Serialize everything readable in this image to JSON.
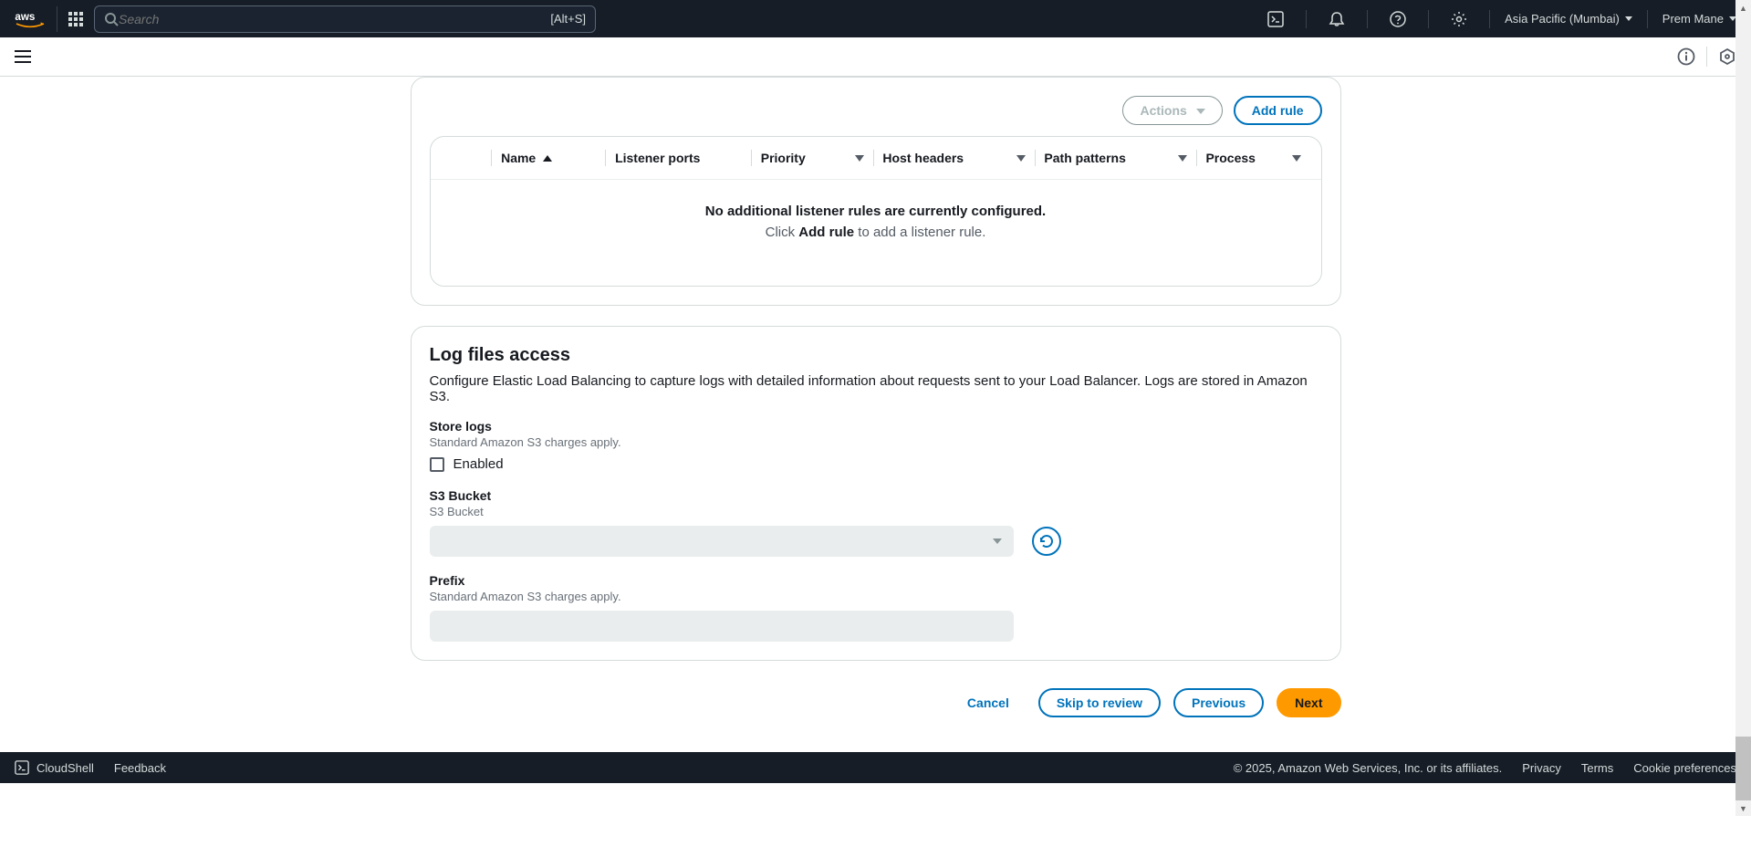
{
  "header": {
    "search_placeholder": "Search",
    "search_shortcut": "[Alt+S]",
    "region": "Asia Pacific (Mumbai)",
    "user": "Prem Mane"
  },
  "rules_panel": {
    "actions_label": "Actions",
    "add_rule_label": "Add rule",
    "columns": {
      "name": "Name",
      "listener_ports": "Listener ports",
      "priority": "Priority",
      "host_headers": "Host headers",
      "path_patterns": "Path patterns",
      "process": "Process"
    },
    "empty_title": "No additional listener rules are currently configured.",
    "empty_sub_before": "Click ",
    "empty_sub_bold": "Add rule",
    "empty_sub_after": " to add a listener rule."
  },
  "log_panel": {
    "title": "Log files access",
    "description": "Configure Elastic Load Balancing to capture logs with detailed information about requests sent to your Load Balancer. Logs are stored in Amazon S3.",
    "store_logs_label": "Store logs",
    "store_logs_hint": "Standard Amazon S3 charges apply.",
    "enabled_label": "Enabled",
    "s3_bucket_label": "S3 Bucket",
    "s3_bucket_hint": "S3 Bucket",
    "prefix_label": "Prefix",
    "prefix_hint": "Standard Amazon S3 charges apply."
  },
  "actions": {
    "cancel": "Cancel",
    "skip": "Skip to review",
    "previous": "Previous",
    "next": "Next"
  },
  "footer": {
    "cloudshell": "CloudShell",
    "feedback": "Feedback",
    "copyright": "© 2025, Amazon Web Services, Inc. or its affiliates.",
    "privacy": "Privacy",
    "terms": "Terms",
    "cookies": "Cookie preferences"
  }
}
